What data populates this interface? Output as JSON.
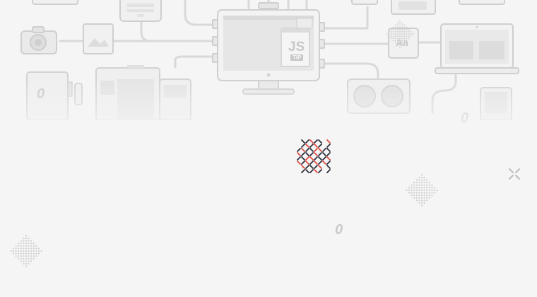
{
  "illustration": {
    "monitor_badge_main": "JS",
    "monitor_badge_sub": "TIP",
    "tablet_badge": "Aa",
    "zero_glyph": "0"
  },
  "loader": {
    "icon": "loading-spinner-icon"
  },
  "colors": {
    "background": "#f5f5f5",
    "line": "#d6d6d6",
    "device_fill": "#eeeeee",
    "device_stroke": "#cfcfcf",
    "spinner_dark": "#2d2d3a",
    "spinner_red": "#e2483d",
    "close_icon": "#bdbdbd"
  }
}
